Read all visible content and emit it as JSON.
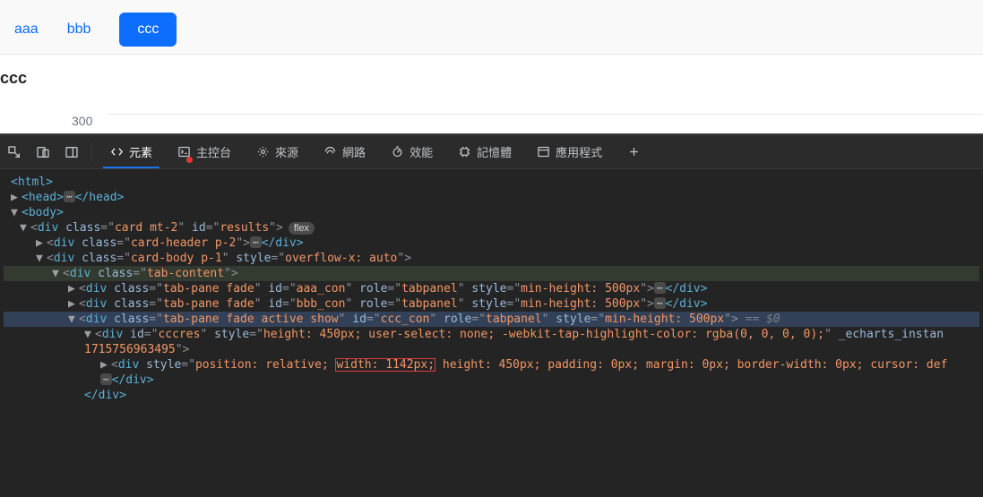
{
  "page": {
    "tabs": [
      {
        "label": "aaa",
        "active": false
      },
      {
        "label": "bbb",
        "active": false
      },
      {
        "label": "ccc",
        "active": true
      }
    ],
    "heading": "ccc",
    "axis_tick": "300"
  },
  "devtools": {
    "toolbar_tabs": {
      "elements": "元素",
      "console": "主控台",
      "sources": "來源",
      "network": "網路",
      "performance": "效能",
      "memory": "記憶體",
      "application": "應用程式"
    },
    "flex_badge": "flex",
    "selected_marker": "== $0",
    "dom": {
      "l0": "<html>",
      "l1_open": "<head>",
      "l1_close": "</head>",
      "l2": "<body>",
      "l3_tag": "div",
      "l3_class": "card mt-2",
      "l3_id": "results",
      "l4_tag": "div",
      "l4_class": "card-header p-2",
      "l4_close": "</div>",
      "l5_tag": "div",
      "l5_class": "card-body p-1",
      "l5_style": "overflow-x: auto",
      "l6_tag": "div",
      "l6_class": "tab-content",
      "panes": [
        {
          "id": "aaa_con",
          "class": "tab-pane fade",
          "role": "tabpanel",
          "style": "min-height: 500px"
        },
        {
          "id": "bbb_con",
          "class": "tab-pane fade",
          "role": "tabpanel",
          "style": "min-height: 500px"
        },
        {
          "id": "ccc_con",
          "class": "tab-pane fade active show",
          "role": "tabpanel",
          "style": "min-height: 500px"
        }
      ],
      "cccres": {
        "tag": "div",
        "id": "cccres",
        "style": "height: 450px; user-select: none; -webkit-tap-highlight-color: rgba(0, 0, 0, 0);",
        "attr_tail": "_echarts_instan",
        "inst_val": "1715756963495",
        "inner_tag": "div",
        "inner_style_pre": "position: relative;",
        "inner_style_boxed": "width: 1142px;",
        "inner_style_post": "height: 450px; padding: 0px; margin: 0px; border-width: 0px; cursor: def",
        "inner_close": "</div>",
        "close": "</div>"
      }
    }
  }
}
